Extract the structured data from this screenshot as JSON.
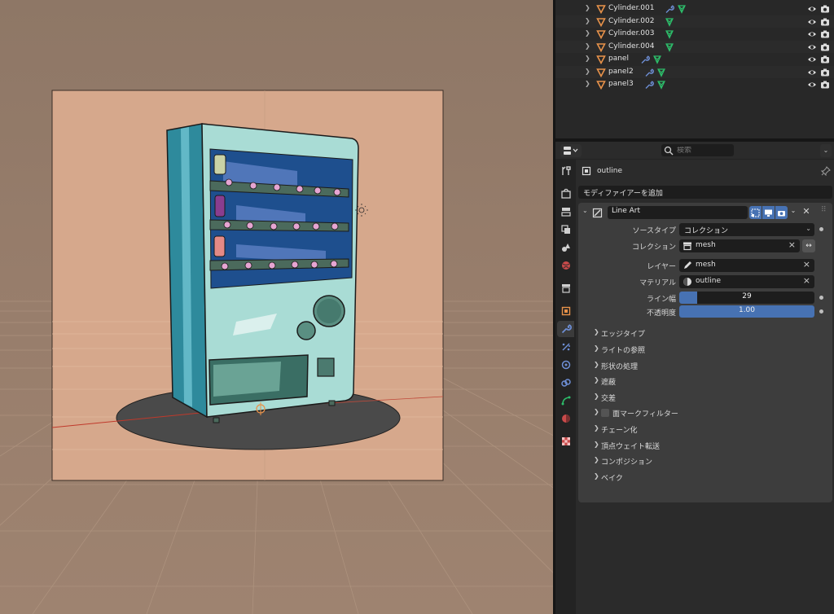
{
  "outliner": {
    "items": [
      {
        "name": "Cylinder.001",
        "has_modifier": true
      },
      {
        "name": "Cylinder.002",
        "has_modifier": false
      },
      {
        "name": "Cylinder.003",
        "has_modifier": false
      },
      {
        "name": "Cylinder.004",
        "has_modifier": false
      },
      {
        "name": "panel",
        "has_modifier": true
      },
      {
        "name": "panel2",
        "has_modifier": true
      },
      {
        "name": "panel3",
        "has_modifier": true
      }
    ]
  },
  "properties": {
    "search_placeholder": "検索",
    "object_name": "outline",
    "add_modifier_label": "モディファイアーを追加",
    "modifier": {
      "name": "Line Art",
      "source_type": {
        "label": "ソースタイプ",
        "value": "コレクション"
      },
      "collection": {
        "label": "コレクション",
        "value": "mesh"
      },
      "layer": {
        "label": "レイヤー",
        "value": "mesh"
      },
      "material": {
        "label": "マテリアル",
        "value": "outline"
      },
      "line_width": {
        "label": "ライン幅",
        "value": "29",
        "fraction": 0.13
      },
      "opacity": {
        "label": "不透明度",
        "value": "1.00",
        "fraction": 1.0
      },
      "subpanels": [
        {
          "label": "エッジタイプ",
          "checkbox": false
        },
        {
          "label": "ライトの参照",
          "checkbox": false
        },
        {
          "label": "形状の処理",
          "checkbox": false
        },
        {
          "label": "遮蔽",
          "checkbox": false
        },
        {
          "label": "交差",
          "checkbox": false
        },
        {
          "label": "面マークフィルター",
          "checkbox": true
        },
        {
          "label": "チェーン化",
          "checkbox": false
        },
        {
          "label": "頂点ウェイト転送",
          "checkbox": false
        },
        {
          "label": "コンポジション",
          "checkbox": false
        },
        {
          "label": "ベイク",
          "checkbox": false
        }
      ]
    }
  },
  "icons": {
    "object_type": "triangle-mesh-icon",
    "modifier": "wrench-icon",
    "mesh_data": "mesh-data-icon",
    "visibility": "eye-icon",
    "render": "camera-icon"
  },
  "colors": {
    "accent": "#4772b3",
    "object_orange": "#e8924a",
    "wrench_blue": "#6e8fd6",
    "mesh_green": "#2dbd6a"
  }
}
